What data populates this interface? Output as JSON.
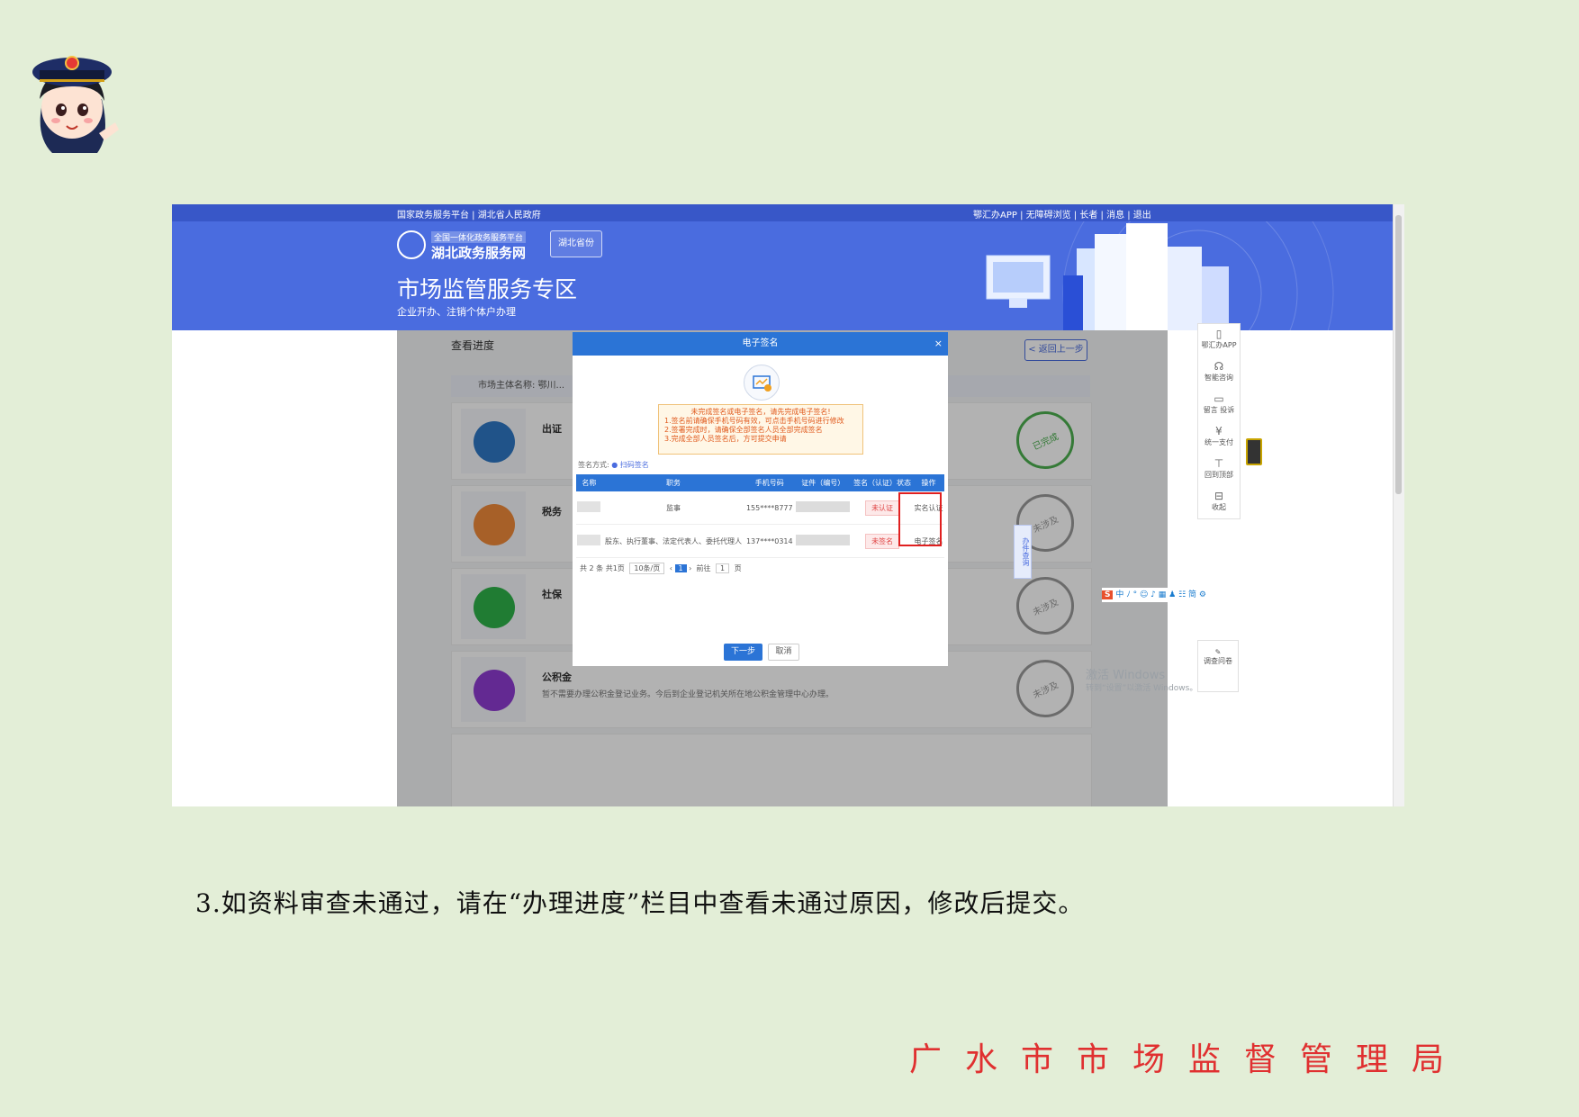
{
  "portal": {
    "top_links_left": "国家政务服务平台 | 湖北省人民政府",
    "top_links_right": "鄂汇办APP | 无障碍浏览 | 长者 | 消息 | 退出",
    "logo_sub": "全国一体化政务服务平台",
    "logo_main": "湖北政务服务网",
    "region": "湖北省份",
    "zone_title": "市场监管服务专区",
    "zone_subtitle": "企业开办、注销个体户办理"
  },
  "page": {
    "progress_tab": "查看进度",
    "back_button": "< 返回上一步",
    "entity_strip": "市场主体名称: 鄂川..."
  },
  "rows": [
    {
      "title": "出证",
      "status": "已完成"
    },
    {
      "title": "税务",
      "status": "未涉及"
    },
    {
      "title": "社保",
      "status": "未涉及"
    },
    {
      "title": "公积金",
      "desc": "暂不需要办理公积金登记业务。今后到企业登记机关所在地公积金管理中心办理。",
      "status": "未涉及"
    }
  ],
  "modal": {
    "title": "电子签名",
    "close": "×",
    "notice_title": "未完成签名或电子签名，请先完成电子签名!",
    "notice_lines": [
      "1.签名前请确保手机号码有效，可点击手机号码进行修改",
      "2.签署完成时，请确保全部签名人员全部完成签名",
      "3.完成全部人员签名后，方可提交申请"
    ],
    "sign_method_label": "签名方式:",
    "sign_method_value": "扫码签名",
    "columns": [
      "名称",
      "职务",
      "手机号码",
      "证件（编号）",
      "签名（认证）状态",
      "操作"
    ],
    "signers": [
      {
        "duty": "监事",
        "phone": "155****8777",
        "status": "未认证",
        "op": "实名认证"
      },
      {
        "duty": "股东、执行董事、法定代表人、委托代理人",
        "phone": "137****0314",
        "status": "未签名",
        "op": "电子签名"
      }
    ],
    "pager_total": "共 2 条  共1页",
    "pager_size": "10条/页",
    "pager_page": "1",
    "pager_goto": "前往",
    "pager_goto_page": "1",
    "pager_unit": "页",
    "next_button": "下一步",
    "cancel_button": "取消"
  },
  "side_tools": [
    "鄂汇办APP",
    "智能咨询",
    "留言 投诉",
    "统一支付",
    "回到顶部",
    "收起"
  ],
  "side_tools2": "调查问卷",
  "vert_tab": "办件查询",
  "ime_bar": "中 ﾉ ° ☺ ♪ ▦ ♟ ☷ 简 ⚙",
  "watermark": {
    "line1": "激活 Windows",
    "line2": "转到“设置”以激活 Windows。"
  },
  "instruction": "3.如资料审查未通过，请在“办理进度”栏目中查看未通过原因，修改后提交。",
  "footer_org": "广水市市场监督管理局"
}
